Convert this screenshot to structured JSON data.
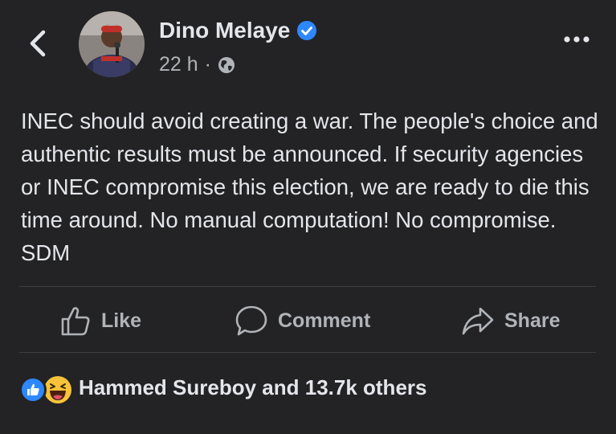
{
  "post": {
    "author": "Dino Melaye",
    "verified": true,
    "time": "22 h",
    "separator": "·",
    "audience_icon": "globe-icon",
    "text": "INEC should avoid creating a war. The people's choice and authentic results must be announced. If security agencies or INEC compromise this election, we are ready to die this time around. No manual computation! No compromise. SDM"
  },
  "actions": {
    "like": "Like",
    "comment": "Comment",
    "share": "Share"
  },
  "reactions": {
    "icons": [
      "like-reaction-icon",
      "haha-reaction-icon"
    ],
    "summary": "Hammed Sureboy and 13.7k others"
  },
  "colors": {
    "background": "#232325",
    "text": "#e4e6eb",
    "secondary_text": "#b0b3b8",
    "divider": "#3e4042",
    "accent_blue": "#2d88ff"
  }
}
